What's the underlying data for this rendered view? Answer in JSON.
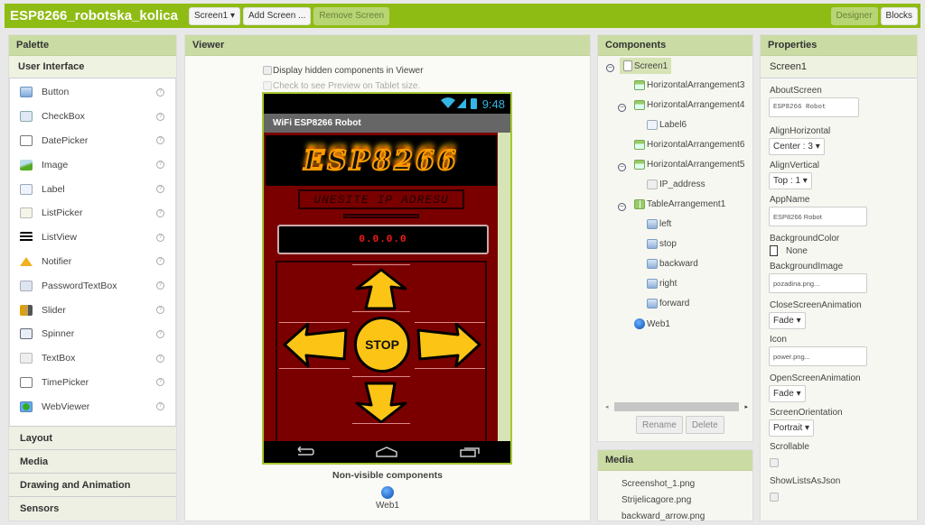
{
  "topbar": {
    "title": "ESP8266_robotska_kolica",
    "screen_select": "Screen1 ▾",
    "add_screen": "Add Screen ...",
    "remove_screen": "Remove Screen",
    "designer": "Designer",
    "blocks": "Blocks",
    "accent": "#8fbc14"
  },
  "palette": {
    "title": "Palette",
    "category_open": "User Interface",
    "items": [
      {
        "label": "Button",
        "icon": "button-icon"
      },
      {
        "label": "CheckBox",
        "icon": "checkbox-icon"
      },
      {
        "label": "DatePicker",
        "icon": "datepicker-icon"
      },
      {
        "label": "Image",
        "icon": "image-icon"
      },
      {
        "label": "Label",
        "icon": "label-icon"
      },
      {
        "label": "ListPicker",
        "icon": "listpicker-icon"
      },
      {
        "label": "ListView",
        "icon": "listview-icon"
      },
      {
        "label": "Notifier",
        "icon": "notifier-icon"
      },
      {
        "label": "PasswordTextBox",
        "icon": "password-icon"
      },
      {
        "label": "Slider",
        "icon": "slider-icon"
      },
      {
        "label": "Spinner",
        "icon": "spinner-icon"
      },
      {
        "label": "TextBox",
        "icon": "textbox-icon"
      },
      {
        "label": "TimePicker",
        "icon": "timepicker-icon"
      },
      {
        "label": "WebViewer",
        "icon": "webviewer-icon"
      }
    ],
    "help_glyph": "?",
    "categories": [
      "Layout",
      "Media",
      "Drawing and Animation",
      "Sensors"
    ]
  },
  "viewer": {
    "title": "Viewer",
    "display_hidden": "Display hidden components in Viewer",
    "tablet_preview": "Check to see Preview on Tablet size.",
    "phone": {
      "time": "9:48",
      "app_title": "WiFi ESP8266 Robot",
      "logo_text": "ESP8266",
      "prompt": "UNESITE IP ADRESU",
      "ip_value": "0.0.0.0",
      "stop_label": "STOP"
    },
    "nonvisible_title": "Non-visible components",
    "nonvisible_items": [
      "Web1"
    ]
  },
  "components": {
    "title": "Components",
    "tree": [
      {
        "label": "Screen1",
        "depth": 0,
        "toggle": "⊖",
        "icon": "screen-icon"
      },
      {
        "label": "HorizontalArrangement3",
        "depth": 1,
        "toggle": "",
        "icon": "arrangement-icon"
      },
      {
        "label": "HorizontalArrangement4",
        "depth": 1,
        "toggle": "⊖",
        "icon": "arrangement-icon"
      },
      {
        "label": "Label6",
        "depth": 2,
        "toggle": "",
        "icon": "label-icon"
      },
      {
        "label": "HorizontalArrangement6",
        "depth": 1,
        "toggle": "",
        "icon": "arrangement-icon"
      },
      {
        "label": "HorizontalArrangement5",
        "depth": 1,
        "toggle": "⊖",
        "icon": "arrangement-icon"
      },
      {
        "label": "IP_address",
        "depth": 2,
        "toggle": "",
        "icon": "textbox-icon"
      },
      {
        "label": "TableArrangement1",
        "depth": 1,
        "toggle": "⊖",
        "icon": "table-icon"
      },
      {
        "label": "left",
        "depth": 2,
        "toggle": "",
        "icon": "button-icon"
      },
      {
        "label": "stop",
        "depth": 2,
        "toggle": "",
        "icon": "button-icon"
      },
      {
        "label": "backward",
        "depth": 2,
        "toggle": "",
        "icon": "button-icon"
      },
      {
        "label": "right",
        "depth": 2,
        "toggle": "",
        "icon": "button-icon"
      },
      {
        "label": "forward",
        "depth": 2,
        "toggle": "",
        "icon": "button-icon"
      },
      {
        "label": "Web1",
        "depth": 1,
        "toggle": "",
        "icon": "web-icon"
      }
    ],
    "rename": "Rename",
    "delete": "Delete"
  },
  "media": {
    "title": "Media",
    "files": [
      "Screenshot_1.png",
      "Strijelicagore.png",
      "backward_arrow.png"
    ]
  },
  "properties": {
    "title": "Properties",
    "component": "Screen1",
    "about_label": "AboutScreen",
    "about_value": "ESP8266 Robot",
    "alignh_label": "AlignHorizontal",
    "alignh_value": "Center : 3 ▾",
    "alignv_label": "AlignVertical",
    "alignv_value": "Top : 1 ▾",
    "appname_label": "AppName",
    "appname_value": "ESP8266 Robot",
    "bgcolor_label": "BackgroundColor",
    "bgcolor_value": "None",
    "bgimage_label": "BackgroundImage",
    "bgimage_value": "pozadina.png...",
    "closeanim_label": "CloseScreenAnimation",
    "closeanim_value": "Fade ▾",
    "icon_label": "Icon",
    "icon_value": "power.png...",
    "openanim_label": "OpenScreenAnimation",
    "openanim_value": "Fade ▾",
    "orientation_label": "ScreenOrientation",
    "orientation_value": "Portrait ▾",
    "scrollable_label": "Scrollable",
    "showlists_label": "ShowListsAsJson"
  }
}
